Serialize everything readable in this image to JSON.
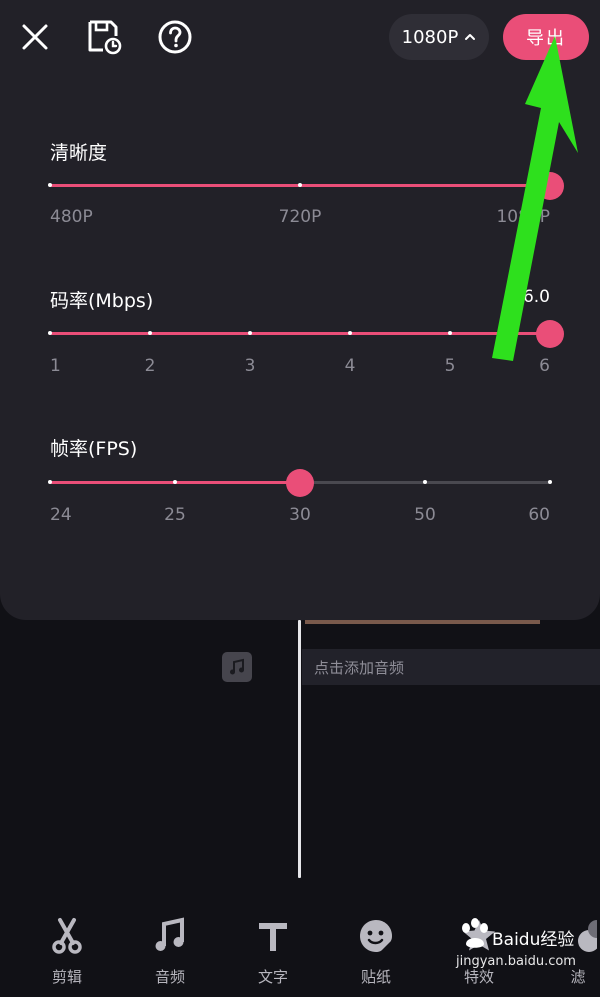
{
  "header": {
    "resolution_label": "1080P",
    "export_label": "导出",
    "icons": [
      "close-icon",
      "save-draft-icon",
      "help-icon",
      "chevron-up-icon"
    ]
  },
  "resolution": {
    "title": "清晰度",
    "options": [
      "480P",
      "720P",
      "1080P"
    ],
    "selected_index": 2
  },
  "bitrate": {
    "title": "码率(Mbps)",
    "value": "6.0",
    "options": [
      "1",
      "2",
      "3",
      "4",
      "5",
      "6"
    ],
    "selected_index": 5
  },
  "framerate": {
    "title": "帧率(FPS)",
    "options": [
      "24",
      "25",
      "30",
      "50",
      "60"
    ],
    "selected_index": 2
  },
  "timeline": {
    "add_audio_label": "点击添加音频"
  },
  "toolbar": {
    "items": [
      {
        "label": "剪辑",
        "icon": "scissors-icon"
      },
      {
        "label": "音频",
        "icon": "music-note-icon"
      },
      {
        "label": "文字",
        "icon": "text-icon"
      },
      {
        "label": "贴纸",
        "icon": "sticker-icon"
      },
      {
        "label": "特效",
        "icon": "star-icon"
      },
      {
        "label": "滤",
        "icon": "filter-icon"
      }
    ]
  },
  "watermark": {
    "text": "jingyan.baidu.com",
    "brand": "Baidu经验"
  },
  "colors": {
    "accent": "#ea4e78",
    "panel_bg": "#222128",
    "app_bg": "#111116",
    "annotation_arrow": "#2ee01d"
  }
}
